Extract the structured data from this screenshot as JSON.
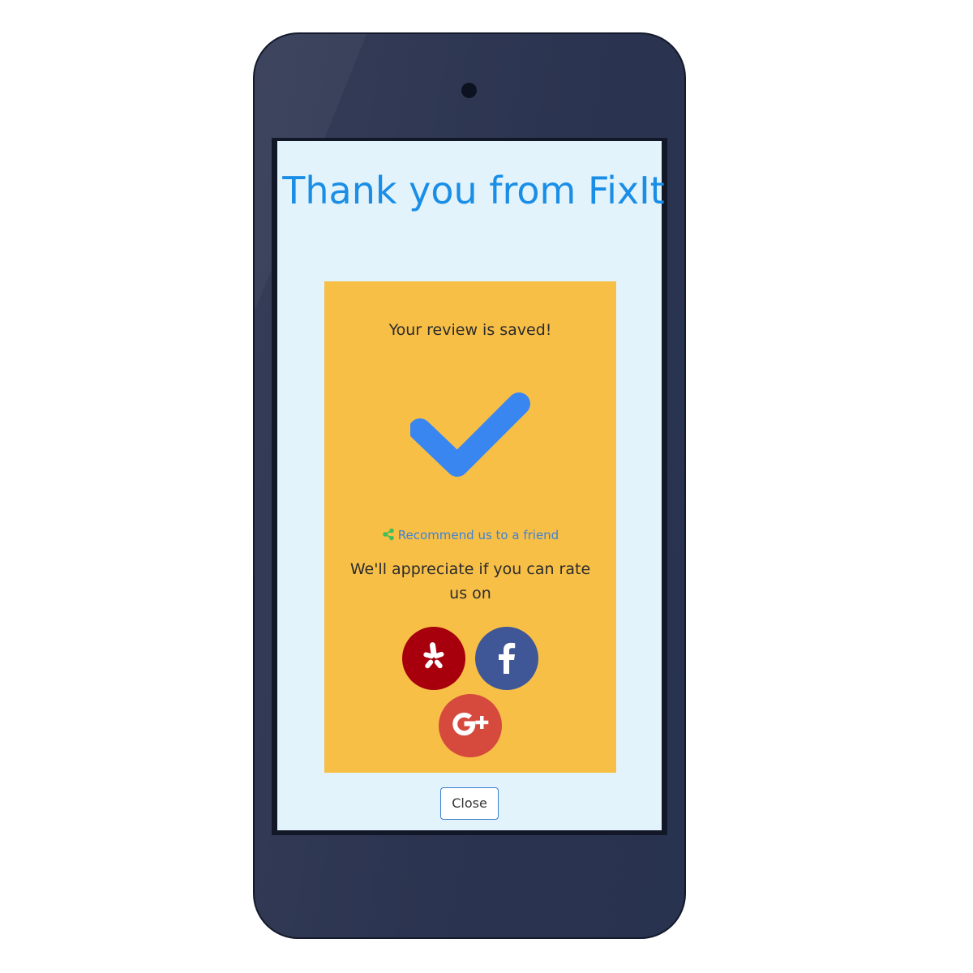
{
  "modal": {
    "title": "Thank you from FixIt",
    "saved_message": "Your review is saved!",
    "recommend_link": "Recommend us to a friend",
    "appreciate_text": "We'll appreciate if you can rate us on",
    "close_label": "Close"
  },
  "social_buttons": [
    {
      "name": "yelp",
      "icon": "yelp-icon",
      "color": "#a7000c"
    },
    {
      "name": "facebook",
      "icon": "facebook-icon",
      "color": "#3f5797",
      "glyph": "f"
    },
    {
      "name": "google-plus",
      "icon": "google-plus-icon",
      "color": "#d54a3d",
      "glyph": "G+"
    }
  ],
  "colors": {
    "title": "#1a8ee6",
    "card": "#f8bf47",
    "checkmark": "#3a86f0",
    "link": "#3b82d8",
    "share_icon": "#3dbf5a",
    "screen_background": "#e3f3fc",
    "phone_body": "#2b3450"
  }
}
